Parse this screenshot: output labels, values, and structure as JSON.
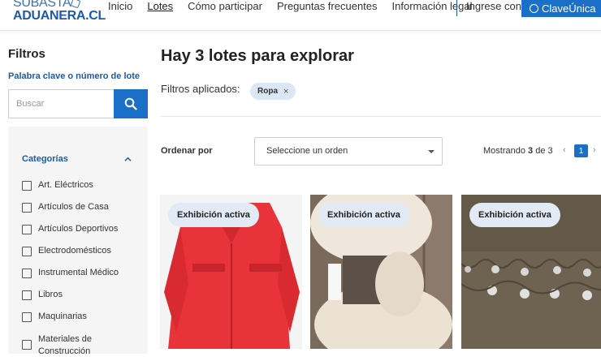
{
  "header": {
    "logo_top": "SUBASTA",
    "logo_bottom": "ADUANERA.CL",
    "nav": [
      {
        "label": "Inicio",
        "active": false
      },
      {
        "label": "Lotes",
        "active": true
      },
      {
        "label": "Cómo participar",
        "active": false
      },
      {
        "label": "Preguntas frecuentes",
        "active": false
      },
      {
        "label": "Información legal",
        "active": false
      }
    ],
    "login_label": "Ingrese con",
    "clave_label": "ClaveÚnica"
  },
  "sidebar": {
    "title": "Filtros",
    "keyword_label": "Palabra clave o número de lote",
    "search_placeholder": "Buscar",
    "categories_title": "Categorías",
    "categories": [
      "Art. Eléctricos",
      "Artículos de Casa",
      "Artículos Deportivos",
      "Electrodomésticos",
      "Instrumental Médico",
      "Libros",
      "Maquinarias",
      "Materiales de Construcción"
    ]
  },
  "main": {
    "title": "Hay 3 lotes para explorar",
    "applied_label": "Filtros aplicados:",
    "applied_filters": [
      "Ropa"
    ],
    "sort_label": "Ordenar por",
    "sort_placeholder": "Seleccione un orden",
    "showing_prefix": "Mostrando",
    "showing_count": "3",
    "showing_middle": "de",
    "showing_total": "3",
    "current_page": "1",
    "prev_symbol": "‹",
    "next_symbol": "›"
  },
  "cards": [
    {
      "badge": "Exhibición activa",
      "image": "red coat"
    },
    {
      "badge": "Exhibición activa",
      "image": "fur collar garment"
    },
    {
      "badge": "Exhibición activa",
      "image": "brown coat with studs"
    }
  ],
  "colors": {
    "brand_blue": "#1a6fc9",
    "link_blue": "#1e5aa8",
    "chip_bg": "#dbe7f5",
    "badge_bg": "#e2ebf5",
    "panel_bg": "#f5f5f5"
  }
}
